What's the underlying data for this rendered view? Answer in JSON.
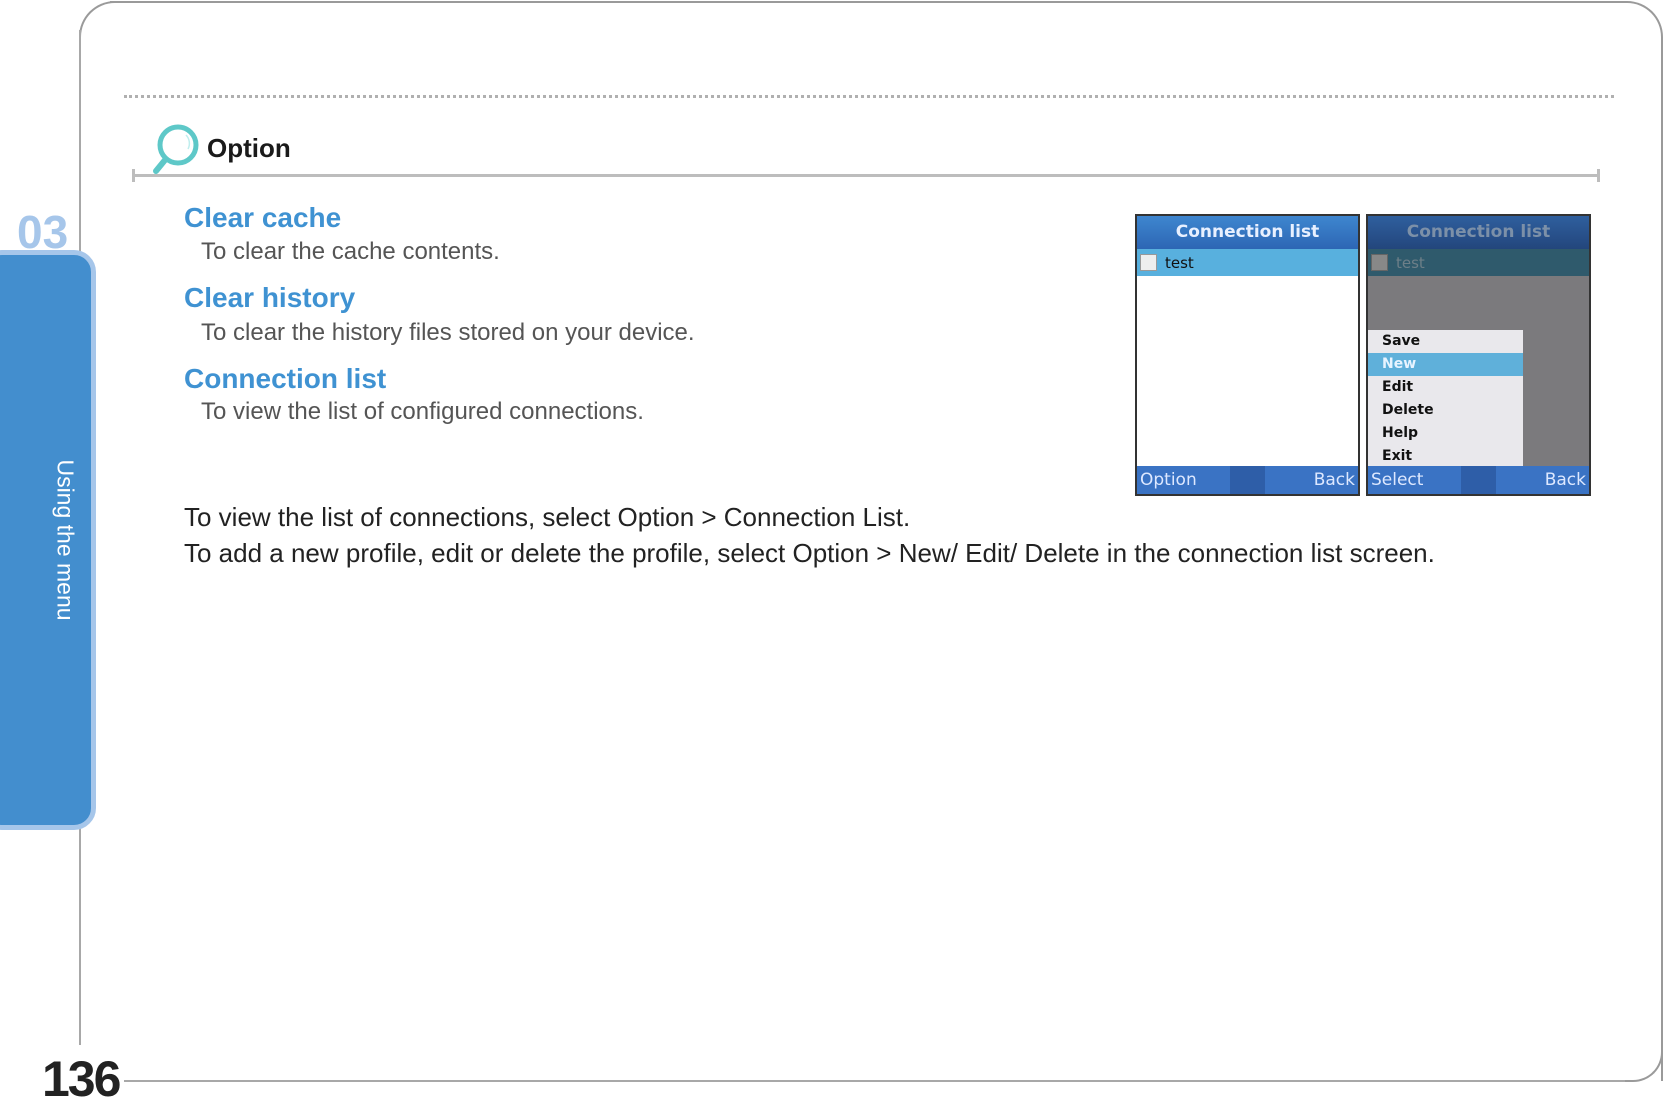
{
  "chapter": {
    "number": "03",
    "label": "Using the menu"
  },
  "page_number": "136",
  "section": {
    "title": "Option",
    "icon": "magnifier-icon"
  },
  "items": [
    {
      "heading": "Clear cache",
      "description": "To clear the cache contents."
    },
    {
      "heading": "Clear history",
      "description": "To clear the history files stored on your device."
    },
    {
      "heading": "Connection list",
      "description": "To view the list of configured connections."
    }
  ],
  "paragraphs": [
    "To view the list of connections, select Option > Connection List.",
    "To add a new profile, edit or delete the profile, select Option > New/ Edit/ Delete in the connection list screen."
  ],
  "screens": [
    {
      "title": "Connection list",
      "row": "test",
      "left_soft": "Option",
      "right_soft": "Back"
    },
    {
      "title": "Connection list",
      "row": "test",
      "left_soft": "Select",
      "right_soft": "Back",
      "menu": [
        "Save",
        "New",
        "Edit",
        "Delete",
        "Help",
        "Exit"
      ],
      "selected": "New"
    }
  ],
  "colors": {
    "accent": "#3f92d2",
    "tab": "#438ece",
    "tab_border": "#a6c6ea",
    "icon": "#5ec8c8"
  }
}
